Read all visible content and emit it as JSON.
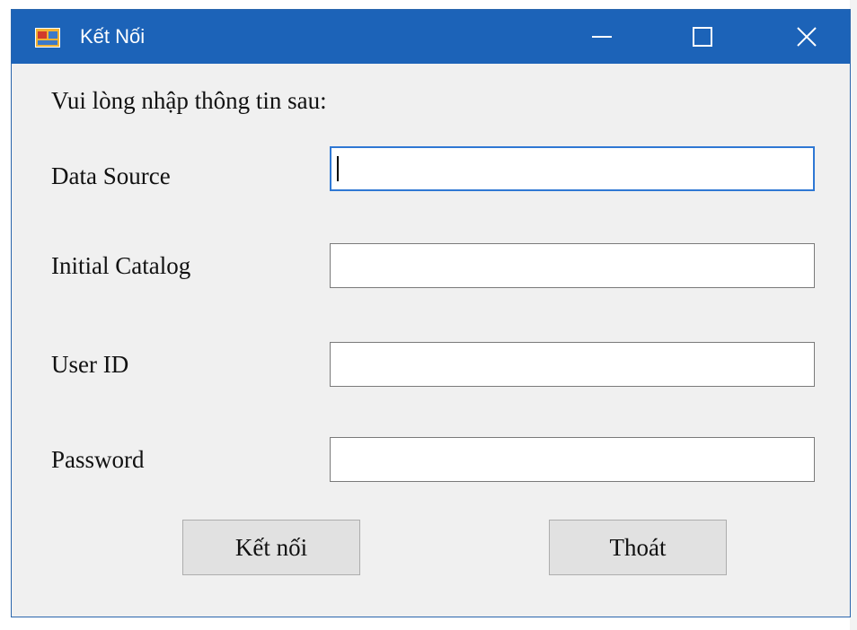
{
  "window": {
    "title": "Kết Nối",
    "icon": "form-window-icon",
    "controls": {
      "minimize_icon": "minimize-icon",
      "maximize_icon": "maximize-icon",
      "close_icon": "close-icon"
    },
    "colors": {
      "titlebar": "#1c63b8",
      "body": "#f0f0f0",
      "focus_border": "#2f78d4"
    }
  },
  "form": {
    "instruction": "Vui lòng nhập thông tin sau:",
    "fields": [
      {
        "label": "Data Source",
        "value": "",
        "focused": true
      },
      {
        "label": "Initial Catalog",
        "value": ""
      },
      {
        "label": "User ID",
        "value": ""
      },
      {
        "label": "Password",
        "value": ""
      }
    ],
    "buttons": {
      "connect": "Kết nối",
      "exit": "Thoát"
    }
  }
}
